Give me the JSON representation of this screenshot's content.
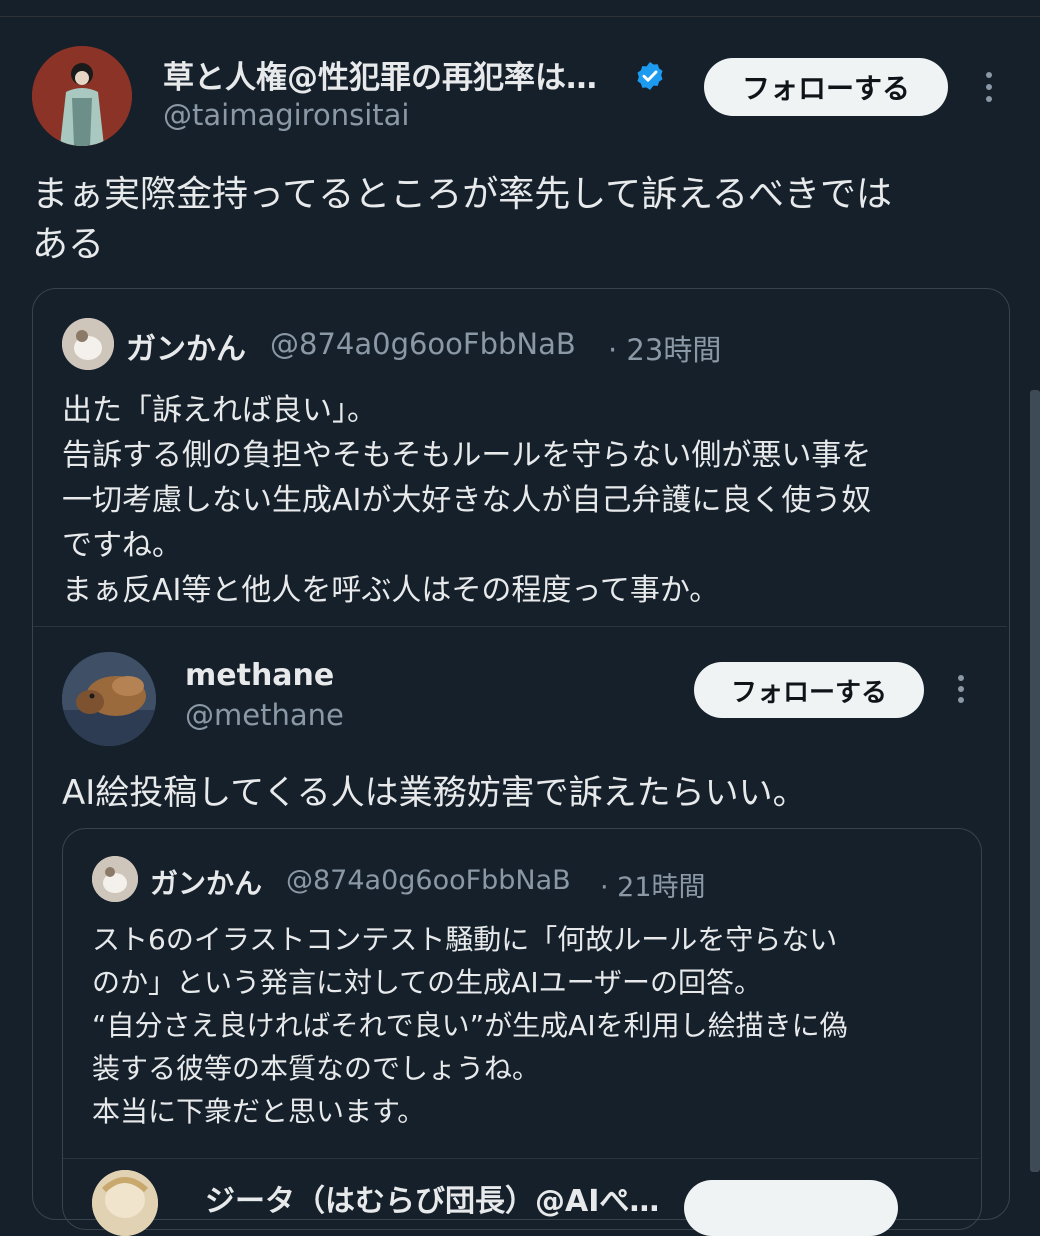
{
  "colors": {
    "background": "#15202b",
    "text": "#e7e9ea",
    "muted": "#8b98a5",
    "verified": "#1d9bf0",
    "border": "#38444d"
  },
  "main_tweet": {
    "display_name": "草と人権@性犯罪の再犯率は…",
    "handle": "@taimagironsitai",
    "follow_label": "フォローする",
    "text": "まぁ実際金持ってるところが率先して訴えるべきでは\nある"
  },
  "quote1": {
    "display_name": "ガンかん",
    "handle": "@874a0g6ooFbbNaB",
    "time": "· 23時間",
    "text": "出た「訴えれば良い」。\n告訴する側の負担やそもそもルールを守らない側が悪い事を\n一切考慮しない生成AIが大好きな人が自己弁護に良く使う奴\nですね。\nまぁ反AI等と他人を呼ぶ人はその程度って事か。"
  },
  "embedded_tweet": {
    "display_name": "methane",
    "handle": "@methane",
    "follow_label": "フォローする",
    "text": "AI絵投稿してくる人は業務妨害で訴えたらいい。"
  },
  "quote2": {
    "display_name": "ガンかん",
    "handle": "@874a0g6ooFbbNaB",
    "time": "· 21時間",
    "text": "スト6のイラストコンテスト騒動に「何故ルールを守らない\nのか」という発言に対しての生成AIユーザーの回答。\n“自分さえ良ければそれで良い”が生成AIを利用し絵描きに偽\n装する彼等の本質なのでしょうね。\n本当に下衆だと思います。"
  },
  "next_tweet": {
    "display_name": "ジータ（はむらび団長）@AIぺ…"
  }
}
